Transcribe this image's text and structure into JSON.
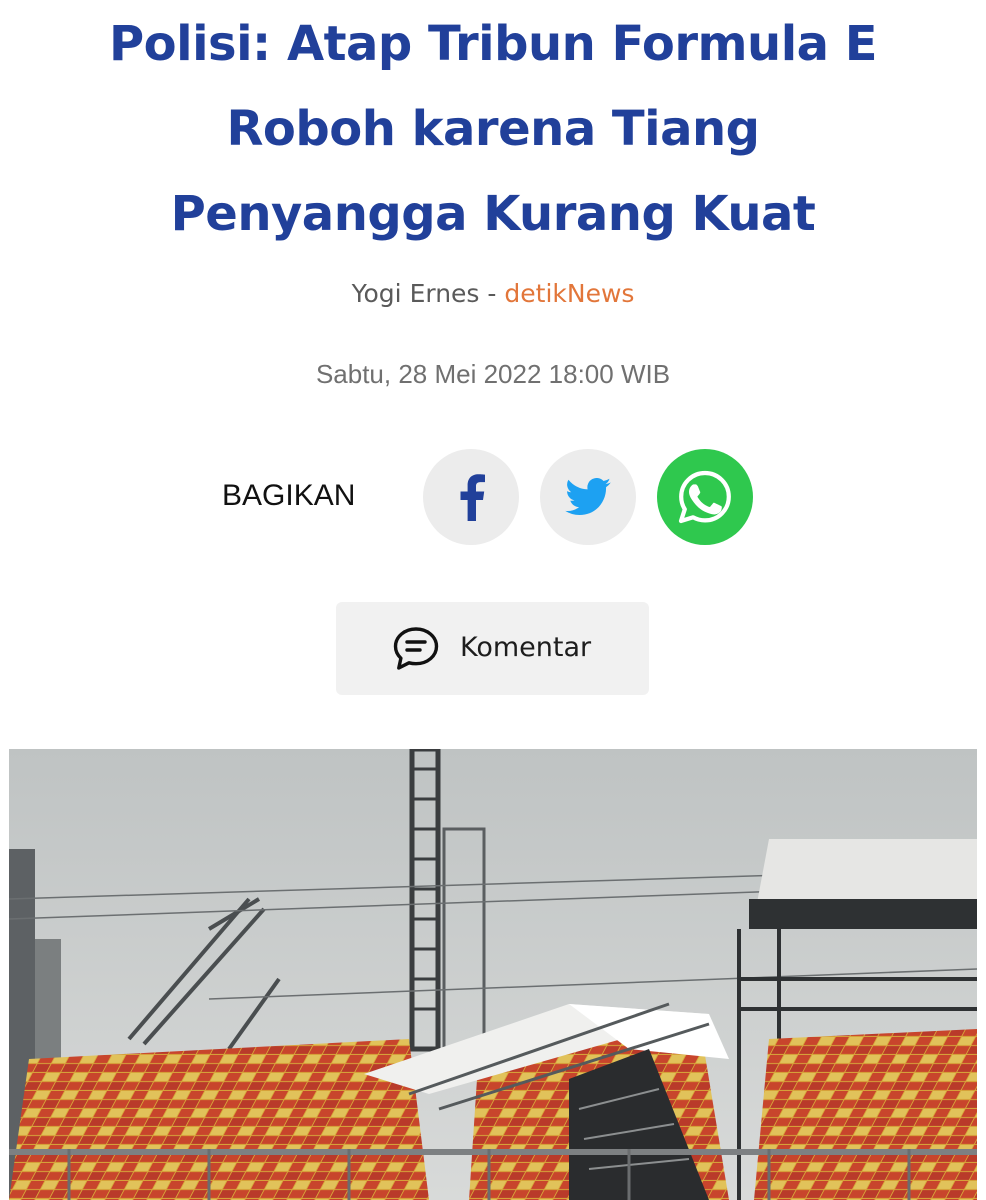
{
  "article": {
    "headline": {
      "line1": "Polisi: Atap Tribun Formula E",
      "line2": "Roboh karena Tiang",
      "line3": "Penyangga Kurang Kuat"
    },
    "byline": {
      "author": "Yogi Ernes",
      "separator": " - ",
      "source": "detikNews"
    },
    "date": "Sabtu, 28 Mei 2022 18:00 WIB"
  },
  "share": {
    "label": "BAGIKAN",
    "buttons": [
      {
        "network": "facebook",
        "icon": "facebook-icon",
        "color": "#21409a"
      },
      {
        "network": "twitter",
        "icon": "twitter-icon",
        "color": "#1da1f2"
      },
      {
        "network": "whatsapp",
        "icon": "whatsapp-icon",
        "color": "#2fc84e"
      }
    ]
  },
  "comment": {
    "label": "Komentar",
    "icon": "comment-icon"
  },
  "colors": {
    "headline": "#21409a",
    "source": "#e2763a",
    "whatsapp": "#2fc84e"
  }
}
